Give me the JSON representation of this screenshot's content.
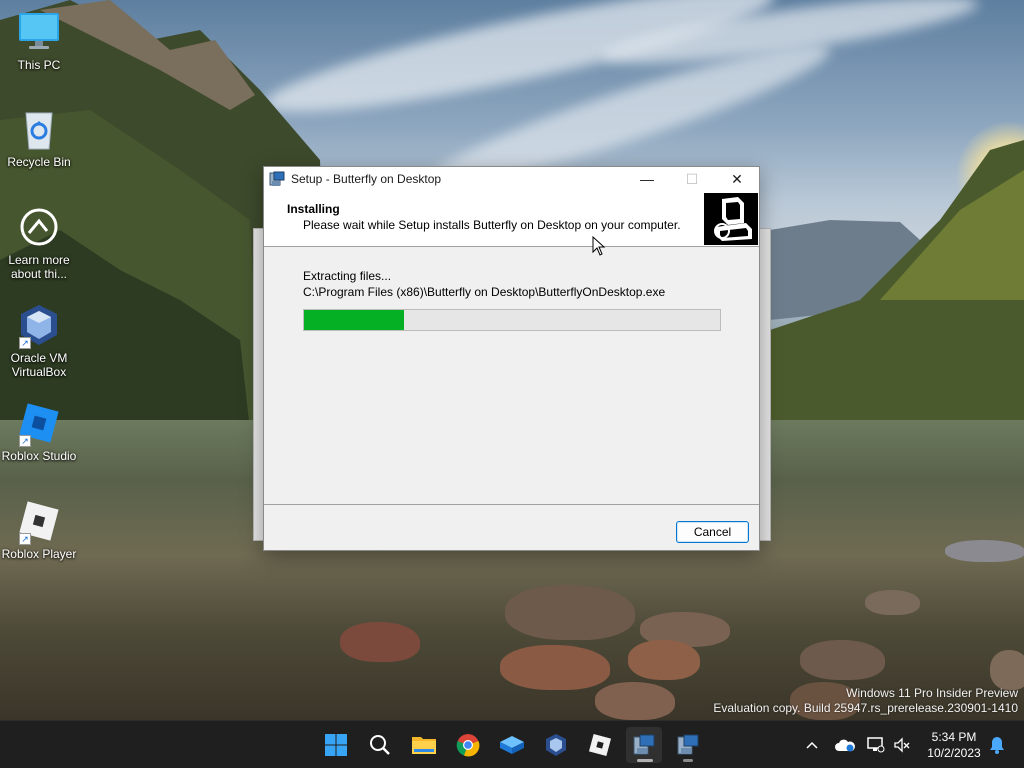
{
  "desktop": {
    "icons": [
      {
        "label": "This PC"
      },
      {
        "label": "Recycle Bin"
      },
      {
        "label": "Learn more about thi..."
      },
      {
        "label": "Oracle VM VirtualBox"
      },
      {
        "label": "Roblox Studio"
      },
      {
        "label": "Roblox Player"
      }
    ],
    "watermark": {
      "line1": "Windows 11 Pro Insider Preview",
      "line2": "Evaluation copy. Build 25947.rs_prerelease.230901-1410"
    }
  },
  "setup_window": {
    "title": "Setup - Butterfly on Desktop",
    "header_title": "Installing",
    "header_subtitle": "Please wait while Setup installs Butterfly on Desktop on your computer.",
    "status_text": "Extracting files...",
    "current_file": "C:\\Program Files (x86)\\Butterfly on Desktop\\ButterflyOnDesktop.exe",
    "progress_fraction": 0.24,
    "progress_color": "#06b025",
    "cancel_label": "Cancel",
    "close_glyph": "✕",
    "minimize_glyph": "—",
    "maximize_glyph": "☐"
  },
  "taskbar": {
    "apps": [
      {
        "name": "start-icon"
      },
      {
        "name": "search-icon"
      },
      {
        "name": "file-explorer-icon"
      },
      {
        "name": "chrome-icon"
      },
      {
        "name": "box-app-icon"
      },
      {
        "name": "virtualbox-icon"
      },
      {
        "name": "roblox-icon"
      },
      {
        "name": "setup-installer-icon"
      },
      {
        "name": "setup-installer-icon-2"
      }
    ],
    "tray": {
      "chevron": "^",
      "time": "5:34 PM",
      "date": "10/2/2023"
    }
  }
}
